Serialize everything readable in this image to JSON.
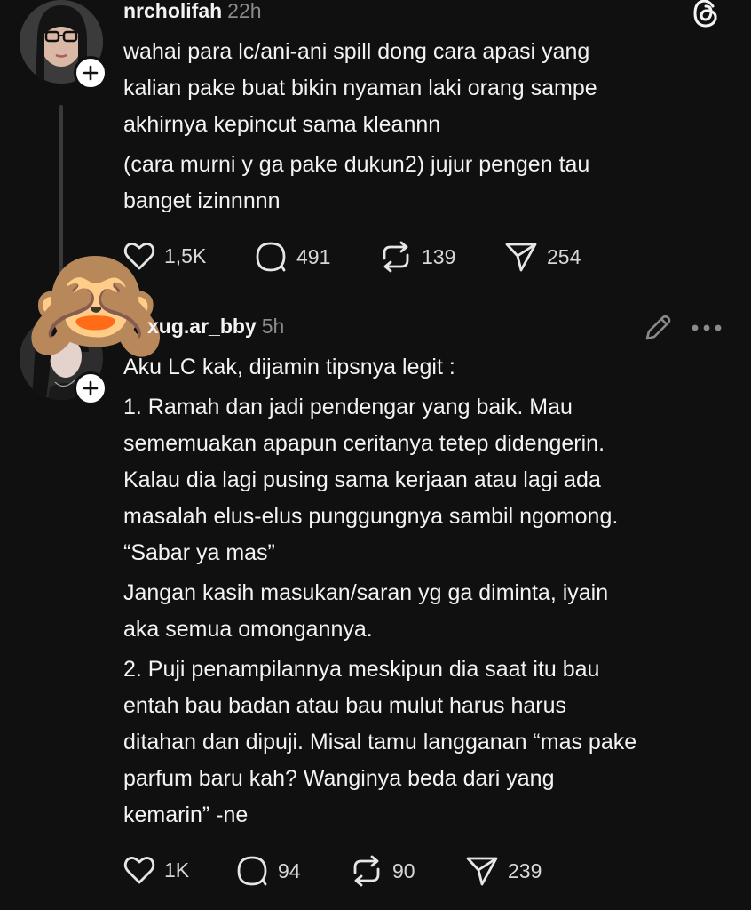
{
  "post": {
    "username": "nrcholifah",
    "time": "22h",
    "paragraphs": [
      "wahai para lc/ani-ani spill dong cara apasi yang",
      "kalian pake buat bikin nyaman laki orang sampe",
      "akhirnya kepincut sama kleannn",
      "(cara murni y ga pake dukun2) jujur pengen tau",
      "banget izinnnnn"
    ],
    "actions": {
      "likes": "1,5K",
      "replies": "491",
      "reposts": "139",
      "shares": "254"
    }
  },
  "reply": {
    "username": "xug.ar_bby",
    "time": "5h",
    "lines": [
      "Aku LC kak, dijamin tipsnya legit :",
      "1. Ramah dan jadi pendengar yang baik. Mau",
      "sememuakan apapun ceritanya tetep didengerin.",
      "Kalau dia lagi pusing sama kerjaan atau lagi ada",
      "masalah elus-elus punggungnya sambil ngomong.",
      "“Sabar ya mas”",
      "Jangan kasih masukan/saran yg ga diminta, iyain",
      "aka semua omongannya.",
      "2. Puji penampilannya meskipun dia saat itu bau",
      "entah bau badan atau bau mulut harus harus",
      "ditahan dan dipuji. Misal tamu langganan “mas pake",
      "parfum baru kah? Wanginya beda dari yang",
      "kemarin” -ne"
    ],
    "actions": {
      "likes": "1K",
      "replies": "94",
      "reposts": "90",
      "shares": "239"
    }
  },
  "sticker": {
    "emoji": "🙈"
  },
  "icons": {
    "app_logo": "threads-logo-icon",
    "edit": "pencil-icon",
    "more": "more-dots-icon"
  },
  "colors": {
    "background": "#101010",
    "text": "#f3f3f3",
    "muted": "#8a8a8a"
  }
}
